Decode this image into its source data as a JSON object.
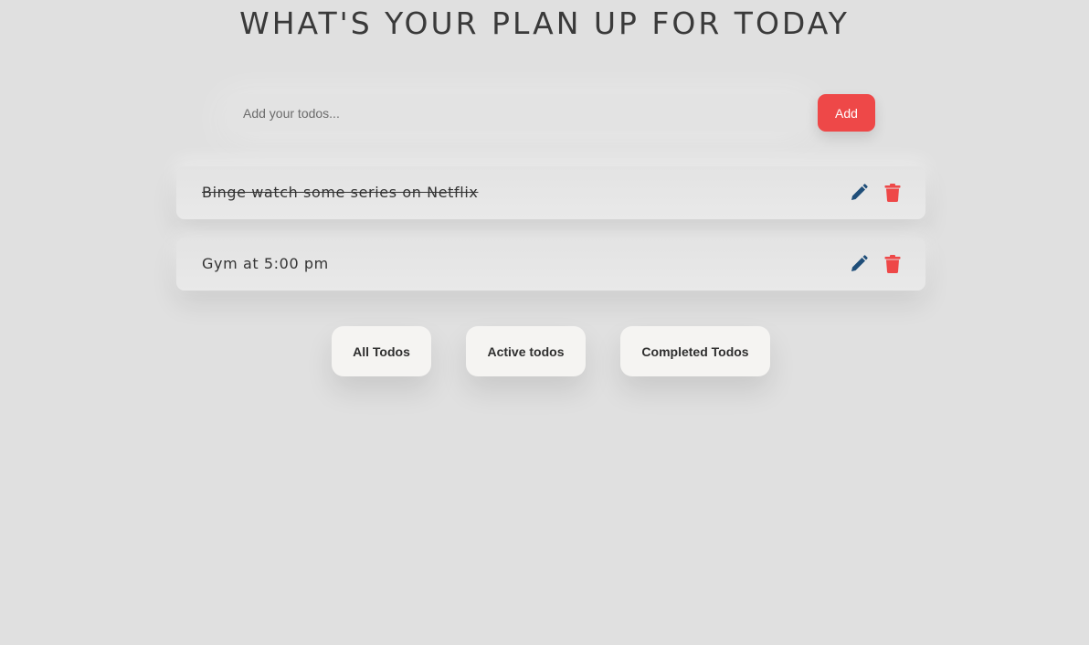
{
  "header": {
    "title": "WHAT'S YOUR PLAN UP FOR TODAY"
  },
  "add_form": {
    "input_placeholder": "Add your todos...",
    "input_value": "",
    "add_label": "Add"
  },
  "todos": [
    {
      "text": "Binge watch some series on Netflix",
      "completed": true,
      "edit_icon": "pencil-icon",
      "delete_icon": "trash-icon"
    },
    {
      "text": "Gym at 5:00 pm",
      "completed": false,
      "edit_icon": "pencil-icon",
      "delete_icon": "trash-icon"
    }
  ],
  "filters": [
    {
      "label": "All Todos"
    },
    {
      "label": "Active todos"
    },
    {
      "label": "Completed Todos"
    }
  ],
  "colors": {
    "background": "#e0e0e0",
    "accent_red": "#ee4848",
    "edit_icon": "#1f4e79",
    "delete_icon": "#ee4848"
  }
}
